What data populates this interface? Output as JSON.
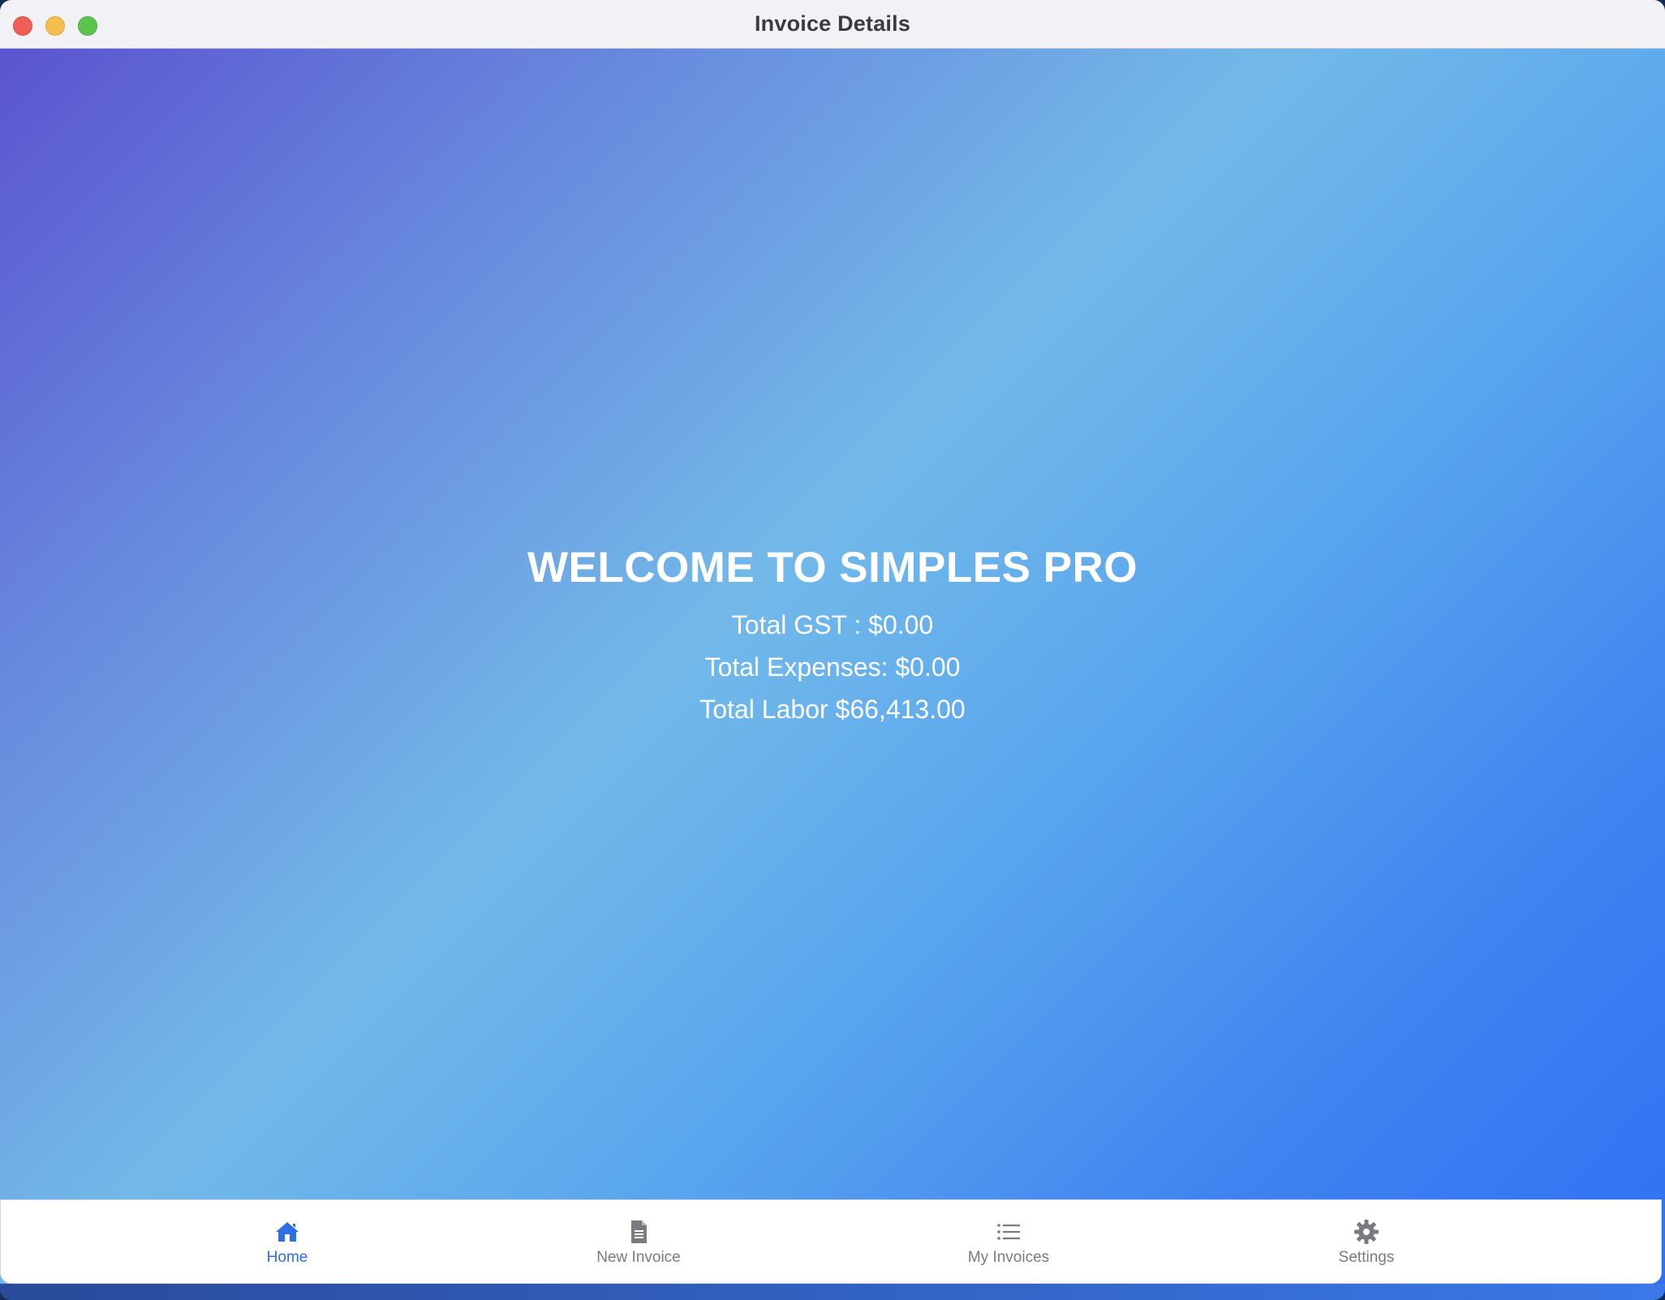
{
  "window": {
    "title": "Invoice Details"
  },
  "main": {
    "welcome": "WELCOME TO SIMPLES PRO",
    "total_gst": "Total GST : $0.00",
    "total_expenses": "Total Expenses: $0.00",
    "total_labor": "Total Labor $66,413.00"
  },
  "tabbar": {
    "tabs": [
      {
        "label": "Home",
        "icon": "home-icon",
        "active": true
      },
      {
        "label": "New Invoice",
        "icon": "document-icon",
        "active": false
      },
      {
        "label": "My Invoices",
        "icon": "list-icon",
        "active": false
      },
      {
        "label": "Settings",
        "icon": "gear-icon",
        "active": false
      }
    ]
  },
  "colors": {
    "accent": "#2f6fe4",
    "inactive_tab": "#7a7a80",
    "gradient_start": "#5a50cf",
    "gradient_mid": "#72b9e9",
    "gradient_end": "#2f70f3"
  }
}
